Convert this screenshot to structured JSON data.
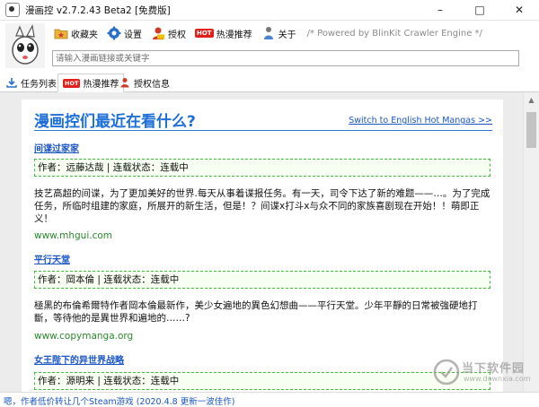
{
  "window": {
    "title": "漫画控 v2.7.2.43 Beta2 [免费版]",
    "controls": [
      "–",
      "□",
      "✕"
    ]
  },
  "toolbar": {
    "favorites": "收藏夹",
    "settings": "设置",
    "license": "授权",
    "hot_badge": "HOT",
    "hot": "热漫推荐",
    "about": "关于",
    "powered": "/* Powered by BlinKit Crawler Engine */"
  },
  "search": {
    "placeholder": "请输入漫画链接或关键字"
  },
  "tabs": [
    {
      "label": "任务列表",
      "badge": ""
    },
    {
      "label": "热漫推荐",
      "badge": "HOT"
    },
    {
      "label": "授权信息",
      "badge": ""
    }
  ],
  "content": {
    "heading": "漫画控们最近在看什么?",
    "switch_link": "Switch to English Hot Mangas >>",
    "items": [
      {
        "title": "间谍过家家",
        "info": "作者：远藤达哉 | 连载状态：连载中",
        "desc": "技艺高超的间谍，为了更加美好的世界.每天从事着谍报任务。有一天，司令下达了新的难题——…。为了完成任务，所临时组建的家庭，所展开的新生活，但是！？间谍x打斗x与众不同的家族喜剧现在开始！！萌即正义！",
        "site": "www.mhgui.com"
      },
      {
        "title": "平行天堂",
        "info": "作者：岡本倫 | 连载状态：连载中",
        "desc": "極黑的布倫希爾特作者岡本倫最新作，美少女遍地的異色幻想曲——平行天堂。少年平靜的日常被強硬地打斷，等待他的是異世界和遍地的……?",
        "site": "www.copymanga.org"
      },
      {
        "title": "女王陛下的异世界战略",
        "info": "作者：源明来 | 连载状态：连载中",
        "desc": "",
        "site": ""
      }
    ]
  },
  "status": {
    "text": "嗯，作者低价转让几个Steam游戏 (2020.4.8 更新一波佳作)"
  },
  "watermark": {
    "main": "当下软件园",
    "sub": "www.downxia.com"
  },
  "colors": {
    "link": "#1a56c4",
    "heading": "#1e6fd8",
    "site": "#2b8a2b",
    "info_border": "#3fbf3f",
    "hot_red": "#e0201b"
  }
}
